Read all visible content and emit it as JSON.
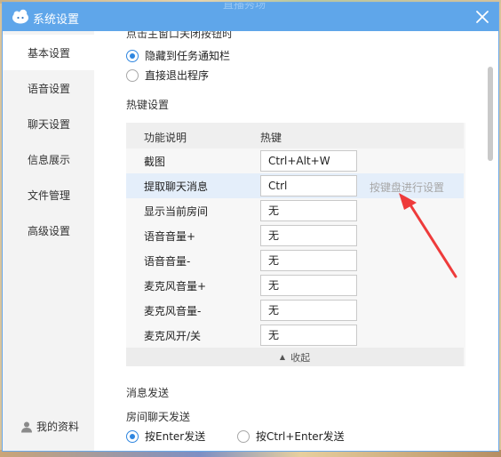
{
  "window": {
    "title": "系统设置",
    "peek_text": "直播秀场"
  },
  "sidebar": {
    "items": [
      {
        "label": "基本设置",
        "active": true
      },
      {
        "label": "语音设置",
        "active": false
      },
      {
        "label": "聊天设置",
        "active": false
      },
      {
        "label": "信息展示",
        "active": false
      },
      {
        "label": "文件管理",
        "active": false
      },
      {
        "label": "高级设置",
        "active": false
      }
    ],
    "profile_label": "我的资料"
  },
  "main": {
    "cut_heading": "点击主窗口关闭按钮时",
    "close_options": [
      {
        "label": "隐藏到任务通知栏",
        "checked": true
      },
      {
        "label": "直接退出程序",
        "checked": false
      }
    ],
    "hotkey_section_title": "热键设置",
    "hotkey_table": {
      "columns": [
        "功能说明",
        "热键"
      ],
      "rows": [
        {
          "function": "截图",
          "key": "Ctrl+Alt+W",
          "hint": ""
        },
        {
          "function": "提取聊天消息",
          "key": "Ctrl",
          "hint": "按键盘进行设置"
        },
        {
          "function": "显示当前房间",
          "key": "无",
          "hint": ""
        },
        {
          "function": "语音音量+",
          "key": "无",
          "hint": ""
        },
        {
          "function": "语音音量-",
          "key": "无",
          "hint": ""
        },
        {
          "function": "麦克风音量+",
          "key": "无",
          "hint": ""
        },
        {
          "function": "麦克风音量-",
          "key": "无",
          "hint": ""
        },
        {
          "function": "麦克风开/关",
          "key": "无",
          "hint": ""
        }
      ],
      "collapse_label": "收起"
    },
    "message_section_title": "消息发送",
    "room_chat_label": "房间聊天发送",
    "send_options": [
      {
        "label": "按Enter发送",
        "checked": true
      },
      {
        "label": "按Ctrl+Enter发送",
        "checked": false
      }
    ]
  },
  "colors": {
    "titlebar": "#5fa6ea",
    "accent": "#2f86e0",
    "annotation_arrow": "#ee3b3b",
    "highlight_row": "#e4eefa"
  },
  "icons": {
    "app": "cloud-mascot-icon",
    "close": "close-icon",
    "profile": "user-icon",
    "collapse": "triangle-up-icon"
  }
}
